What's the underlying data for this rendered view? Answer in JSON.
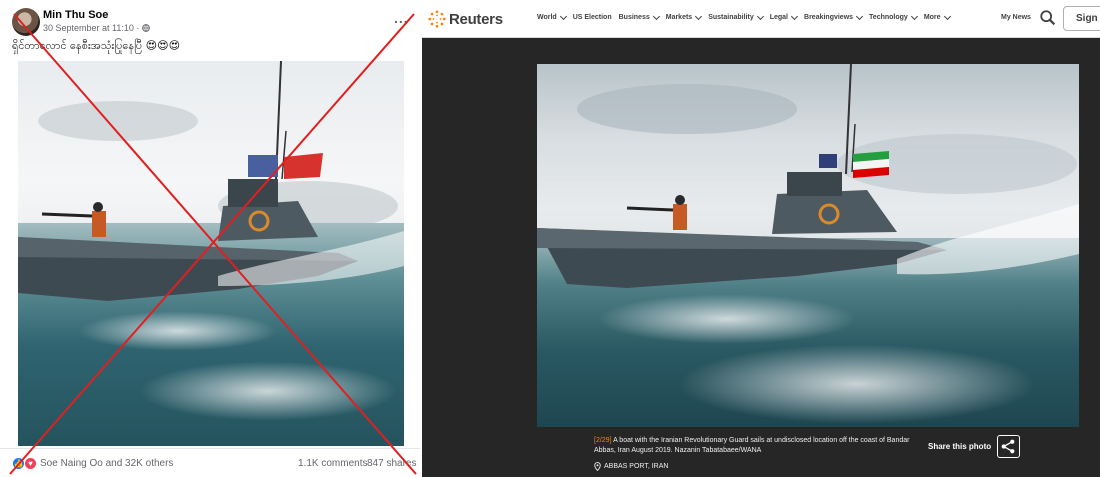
{
  "facebook_post": {
    "author": "Min Thu Soe",
    "timestamp": "30 September at 11:10 ·",
    "privacy_icon": "globe-icon",
    "more_icon": "...",
    "post_text": "ရှိင်တာလောင် နေစီးအသုံးပြုနေပြီ 😍😍😍",
    "reactions": {
      "icons": [
        "like-icon",
        "love-icon"
      ],
      "reactors": "Soe Naing Oo and 32K others",
      "comments": "1.1K comments",
      "shares": "847 shares"
    },
    "false_marker_color": "#e02020"
  },
  "reuters": {
    "logo_text": "Reuters",
    "nav_items": [
      {
        "label": "World",
        "dropdown": true
      },
      {
        "label": "US Election",
        "dropdown": false
      },
      {
        "label": "Business",
        "dropdown": true
      },
      {
        "label": "Markets",
        "dropdown": true
      },
      {
        "label": "Sustainability",
        "dropdown": true
      },
      {
        "label": "Legal",
        "dropdown": true
      },
      {
        "label": "Breakingviews",
        "dropdown": true
      },
      {
        "label": "Technology",
        "dropdown": true
      },
      {
        "label": "More",
        "dropdown": true
      }
    ],
    "my_news": "My News",
    "sign_in": "Sign I",
    "caption_index": "[2/29]",
    "caption": "A boat with the Iranian Revolutionary Guard sails at undisclosed location off the coast of Bandar Abbas, Iran August 2019. Nazanin Tabatabaee/WANA",
    "location": "ABBAS PORT, IRAN",
    "share_label": "Share this photo",
    "accent_color": "#ff8000"
  }
}
